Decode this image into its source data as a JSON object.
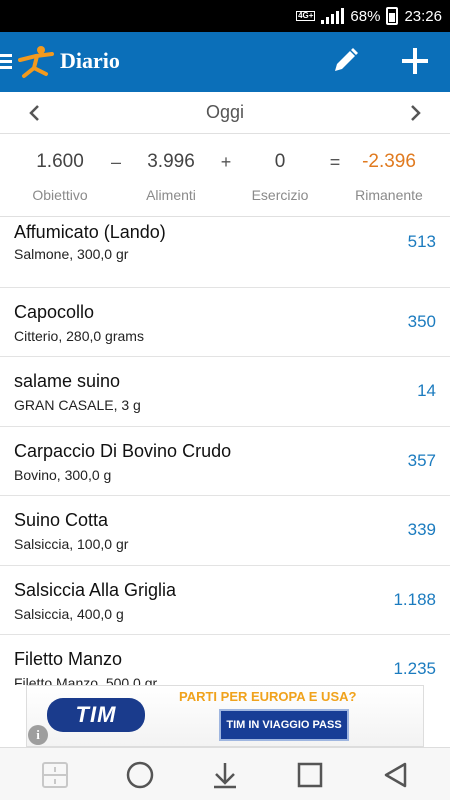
{
  "status_bar": {
    "network": "4G+",
    "battery": "68%",
    "time": "23:26"
  },
  "app_bar": {
    "title": "Diario",
    "icons": [
      "menu-icon",
      "runner-logo-icon",
      "pencil-icon",
      "plus-icon"
    ]
  },
  "date_nav": {
    "label": "Oggi"
  },
  "summary": {
    "goal": {
      "value": "1.600",
      "label": "Obiettivo"
    },
    "minus": "–",
    "food": {
      "value": "3.996",
      "label": "Alimenti"
    },
    "plus": "+",
    "exercise": {
      "value": "0",
      "label": "Esercizio"
    },
    "equals": "=",
    "remaining": {
      "value": "-2.396",
      "label": "Rimanente"
    },
    "remaining_color": "#e07a1f"
  },
  "foods": [
    {
      "name": "Affumicato (Lando)",
      "detail": "Salmone, 300,0 gr",
      "calories": "513"
    },
    {
      "name": "Capocollo",
      "detail": "Citterio, 280,0 grams",
      "calories": "350"
    },
    {
      "name": "salame suino",
      "detail": "GRAN CASALE, 3 g",
      "calories": "14"
    },
    {
      "name": "Carpaccio Di Bovino Crudo",
      "detail": "Bovino, 300,0 g",
      "calories": "357"
    },
    {
      "name": "Suino Cotta",
      "detail": "Salsiccia, 100,0 gr",
      "calories": "339"
    },
    {
      "name": "Salsiccia Alla Griglia",
      "detail": "Salsiccia, 400,0 g",
      "calories": "1.188"
    },
    {
      "name": "Filetto Manzo",
      "detail": "Filetto Manzo, 500,0 gr",
      "calories": "1.235"
    }
  ],
  "ad": {
    "brand": "TIM",
    "headline": "PARTI PER EUROPA E USA?",
    "cta": "TIM IN VIAGGIO PASS",
    "info": "i"
  },
  "colors": {
    "app_bar": "#0b6fb9",
    "calories": "#1b7bbf"
  }
}
